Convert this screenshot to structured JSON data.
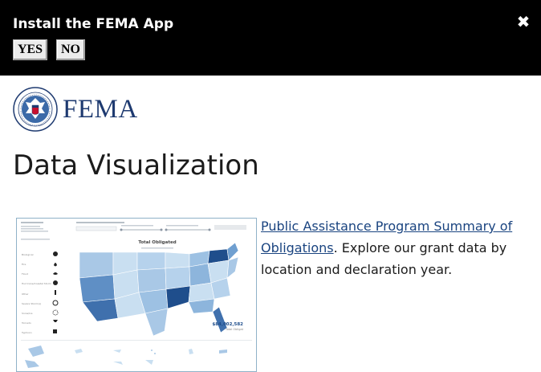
{
  "banner": {
    "title": "Install the FEMA App",
    "yes_label": "YES",
    "no_label": "NO",
    "close_icon": "close-icon"
  },
  "logo": {
    "text": "FEMA",
    "seal_icon": "dhs-seal-icon"
  },
  "page": {
    "title": "Data Visualization"
  },
  "item": {
    "link_text": "Public Assistance Program Summary of Obligations",
    "description": ". Explore our grant data by location and declaration year."
  },
  "thumbnail": {
    "chart_title": "Total Obligated",
    "total_value": "$84,002,582",
    "total_label": "Total Obligat",
    "legend_items": [
      "Biological",
      "Fire",
      "Flood",
      "Hurricane/Coastal Storm",
      "Other",
      "Severe Storm(s)",
      "Snow/Ice",
      "Tornado",
      "Typhoon"
    ]
  },
  "colors": {
    "banner_bg": "#000000",
    "brand_blue": "#1e3a70",
    "link": "#1a4480",
    "map_dark": "#1f4e8c",
    "map_light": "#c9dff1"
  }
}
